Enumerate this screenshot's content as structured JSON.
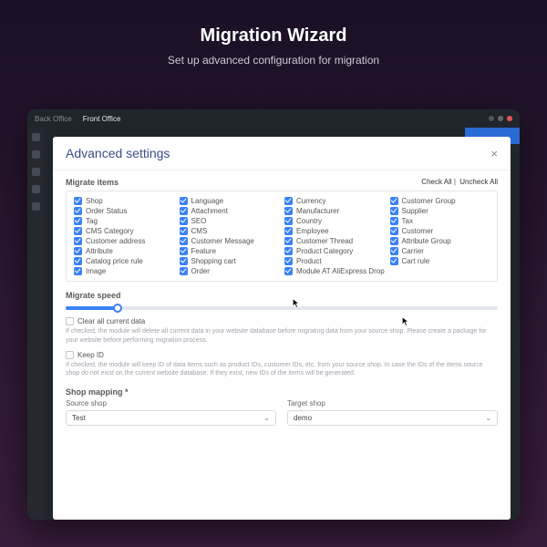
{
  "hero": {
    "title": "Migration Wizard",
    "subtitle": "Set up advanced configuration for migration"
  },
  "topbar": {
    "back": "Back Office",
    "front": "Front Office"
  },
  "modal": {
    "title": "Advanced settings"
  },
  "migrate": {
    "label": "Migrate items",
    "check_all": "Check All",
    "uncheck_all": "Uncheck All",
    "sep": " | ",
    "items": [
      "Shop",
      "Language",
      "Currency",
      "Customer Group",
      "Order Status",
      "Attachment",
      "Manufacturer",
      "Supplier",
      "Tag",
      "SEO",
      "Country",
      "Tax",
      "CMS Category",
      "CMS",
      "Employee",
      "Customer",
      "Customer address",
      "Customer Message",
      "Customer Thread",
      "Attribute Group",
      "Attribute",
      "Feature",
      "Product Category",
      "Carrier",
      "Catalog price rule",
      "Shopping cart",
      "Product",
      "Cart rule",
      "Image",
      "Order",
      "Module AT AliExpress Dropsh…",
      ""
    ]
  },
  "speed": {
    "label": "Migrate speed"
  },
  "opt1": {
    "label": "Clear all current data",
    "checked": false,
    "help": "If checked, the module will delete all current data in your website database before migrating data from your source shop. Please create a package for your website before performing migration process."
  },
  "opt2": {
    "label": "Keep ID",
    "checked": false,
    "help": "If checked, the module will keep ID of data items such as product IDs, customer IDs, etc. from your source shop. In case the IDs of the items source shop do not exist on the current website database. If they exist, new IDs of the items will be generated."
  },
  "mapping": {
    "label": "Shop mapping *",
    "src_label": "Source shop",
    "tgt_label": "Target shop",
    "src_value": "Test",
    "tgt_value": "demo"
  }
}
